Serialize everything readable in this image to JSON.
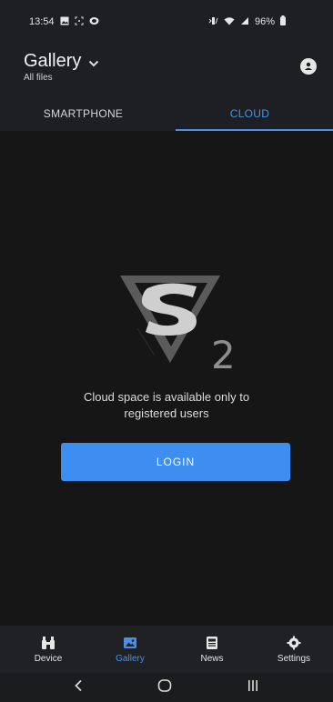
{
  "status": {
    "time": "13:54",
    "battery": "96%",
    "icons_left": [
      "gallery-icon",
      "screenshot-icon",
      "mute-icon"
    ],
    "icons_right": [
      "vibrate-icon",
      "wifi-icon",
      "signal-icon",
      "battery-icon"
    ]
  },
  "header": {
    "title": "Gallery",
    "subtitle": "All files"
  },
  "tabs": [
    {
      "label": "SMARTPHONE",
      "active": false
    },
    {
      "label": "CLOUD",
      "active": true
    }
  ],
  "main": {
    "logo_suffix": "2",
    "message_line1": "Cloud space is available only to",
    "message_line2": "registered users",
    "login_label": "LOGIN"
  },
  "bottom_nav": [
    {
      "label": "Device",
      "icon": "binoculars-icon",
      "active": false
    },
    {
      "label": "Gallery",
      "icon": "image-icon",
      "active": true
    },
    {
      "label": "News",
      "icon": "news-icon",
      "active": false
    },
    {
      "label": "Settings",
      "icon": "gear-icon",
      "active": false
    }
  ],
  "colors": {
    "accent": "#4a90ea",
    "button": "#3d8ef0",
    "background": "#161616",
    "bar": "#1d1f22"
  }
}
